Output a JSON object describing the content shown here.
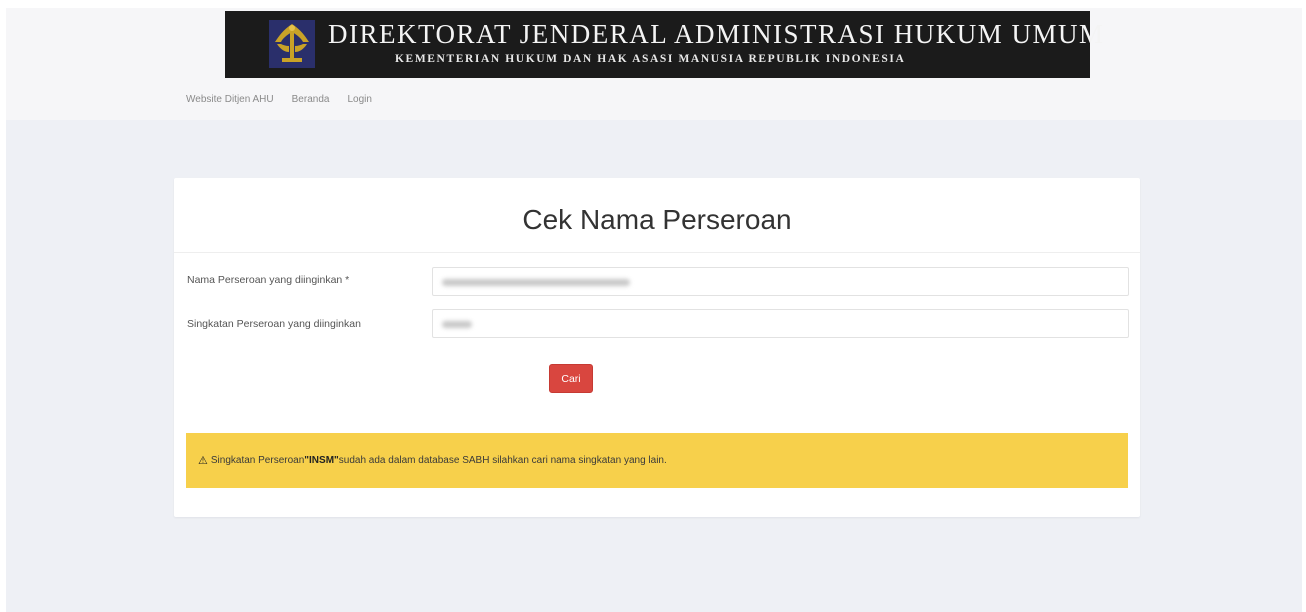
{
  "header": {
    "title": "DIREKTORAT JENDERAL ADMINISTRASI HUKUM UMUM",
    "subtitle": "KEMENTERIAN HUKUM DAN HAK ASASI MANUSIA REPUBLIK INDONESIA",
    "emblem_icon": "pengayoman-emblem-icon",
    "banner_color": "#1b1b1b",
    "emblem_color": "#c9a227"
  },
  "nav": {
    "items": [
      {
        "label": "Website Ditjen AHU"
      },
      {
        "label": "Beranda"
      },
      {
        "label": "Login"
      }
    ]
  },
  "form": {
    "title": "Cek Nama Perseroan",
    "name_label": "Nama Perseroan yang diinginkan *",
    "abbr_label": "Singkatan Perseroan yang diinginkan",
    "submit_label": "Cari",
    "submit_color": "#d9463f"
  },
  "alert": {
    "icon": "warning-icon",
    "prefix": "Singkatan Perseroan ",
    "highlight": "\"INSM\"",
    "suffix": " sudah ada dalam database SABH silahkan cari nama singkatan yang lain.",
    "color": "#f7d04b"
  }
}
